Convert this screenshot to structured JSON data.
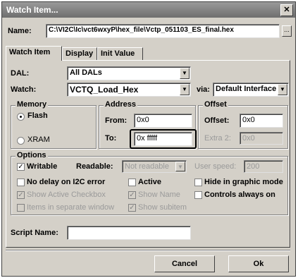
{
  "window": {
    "title": "Watch Item..."
  },
  "name": {
    "label": "Name:",
    "value": "C:\\VI2C\\Ic\\vct6wxyP\\hex_file\\Vctp_051103_ES_final.hex"
  },
  "tabs": [
    {
      "label": "Watch Item"
    },
    {
      "label": "Display"
    },
    {
      "label": "Init Value"
    }
  ],
  "dal": {
    "label": "DAL:",
    "value": "All DALs"
  },
  "watch": {
    "label": "Watch:",
    "value": "VCTQ_Load_Hex",
    "via_label": "via:",
    "via_value": "Default Interface"
  },
  "memory": {
    "title": "Memory",
    "flash": "Flash",
    "xram": "XRAM",
    "selected": "Flash"
  },
  "address": {
    "title": "Address",
    "from_label": "From:",
    "from_value": "0x0",
    "to_label": "To:",
    "to_value": "0x fffff"
  },
  "offset": {
    "title": "Offset",
    "offset_label": "Offset:",
    "offset_value": "0x0",
    "extra_label": "Extra 2:",
    "extra_value": "0x0"
  },
  "options": {
    "title": "Options",
    "writable": "Writable",
    "readable_label": "Readable:",
    "readable_value": "Not readable",
    "user_speed_label": "User speed:",
    "user_speed_value": "200",
    "no_delay": "No delay on I2C error",
    "active": "Active",
    "hide_graphic": "Hide in graphic mode",
    "show_active": "Show Active Checkbox",
    "show_name": "Show Name",
    "controls_on": "Controls always on",
    "items_separate": "Items in separate window",
    "show_subitem": "Show subitem"
  },
  "script": {
    "label": "Script Name:",
    "value": ""
  },
  "buttons": {
    "cancel": "Cancel",
    "ok": "Ok",
    "browse": "..."
  }
}
